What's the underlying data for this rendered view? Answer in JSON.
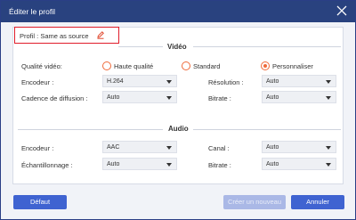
{
  "dialog": {
    "title": "Éditer le profil",
    "profile_label": "Profil : Same as source"
  },
  "video": {
    "section_title": "Vidéo",
    "quality_label": "Qualité vidéo:",
    "quality_options": [
      "Haute qualité",
      "Standard",
      "Personnaliser"
    ],
    "encoder_label": "Encodeur :",
    "encoder_value": "H.264",
    "resolution_label": "Résolution :",
    "resolution_value": "Auto",
    "framerate_label": "Cadence de diffusion :",
    "framerate_value": "Auto",
    "bitrate_label": "Bitrate :",
    "bitrate_value": "Auto"
  },
  "audio": {
    "section_title": "Audio",
    "encoder_label": "Encodeur :",
    "encoder_value": "AAC",
    "channel_label": "Canal :",
    "channel_value": "Auto",
    "samplerate_label": "Échantillonnage :",
    "samplerate_value": "Auto",
    "bitrate_label": "Bitrate :",
    "bitrate_value": "Auto"
  },
  "buttons": {
    "default": "Défaut",
    "new": "Créer un nouveau",
    "cancel": "Annuler"
  },
  "colors": {
    "titlebar": "#29427f",
    "accent": "#ef6a3a",
    "button": "#3f63d1",
    "highlight": "#e01c2a"
  }
}
